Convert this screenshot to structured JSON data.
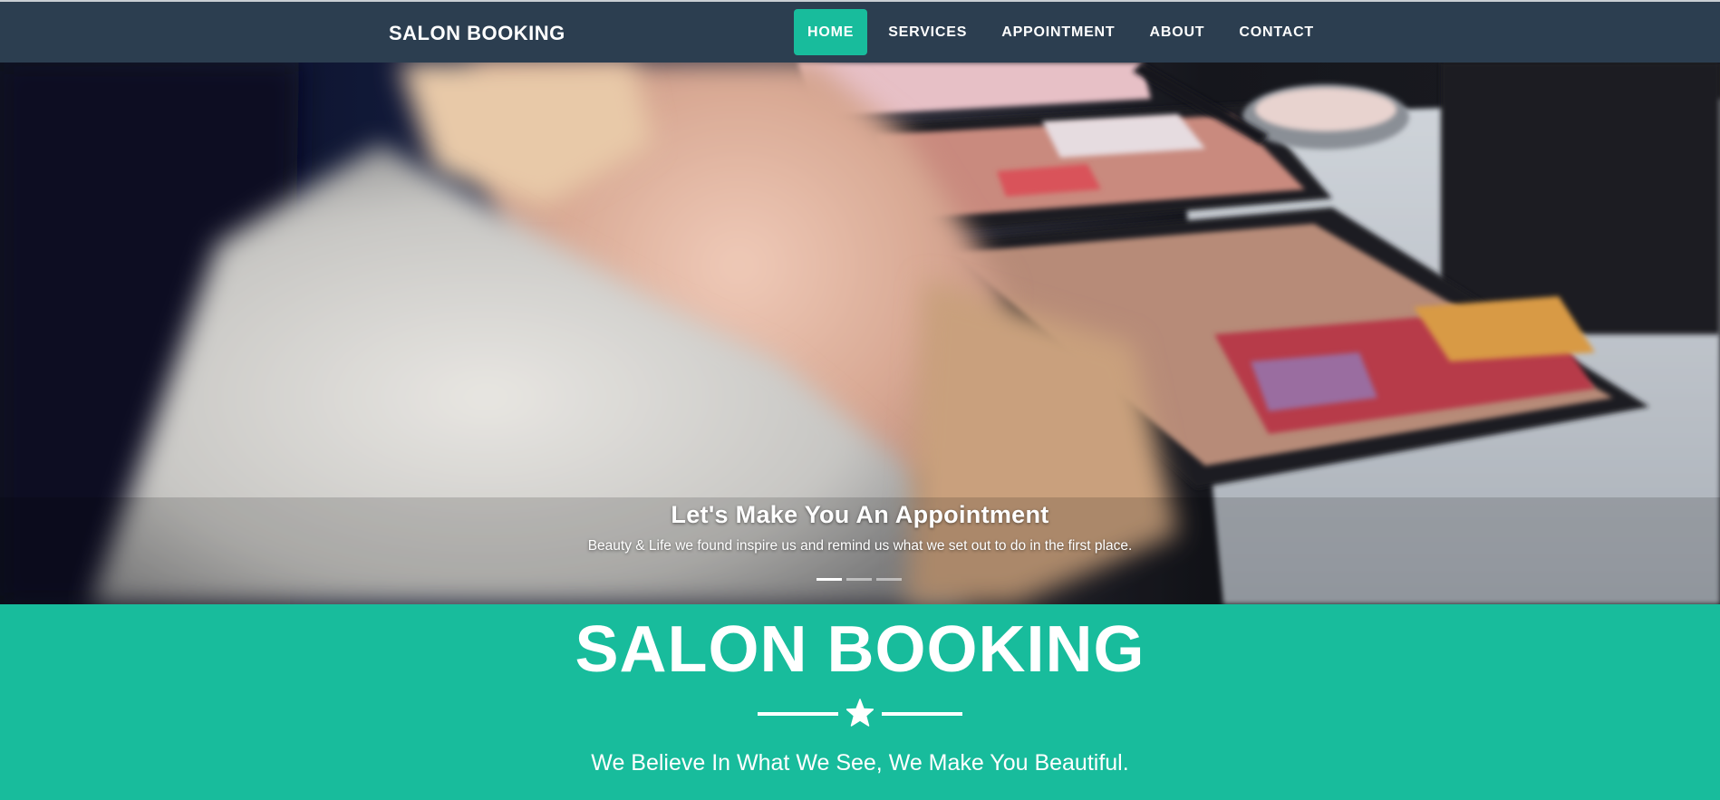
{
  "brand": "SALON BOOKING",
  "nav": {
    "items": [
      {
        "label": "HOME",
        "active": true
      },
      {
        "label": "SERVICES",
        "active": false
      },
      {
        "label": "APPOINTMENT",
        "active": false
      },
      {
        "label": "ABOUT",
        "active": false
      },
      {
        "label": "CONTACT",
        "active": false
      }
    ]
  },
  "hero": {
    "title": "Let's Make You An Appointment",
    "text": "Beauty & Life we found inspire us and remind us what we set out to do in the first place.",
    "slides_total": 3,
    "active_slide": 1
  },
  "masthead": {
    "title": "SALON BOOKING",
    "icon": "star-icon",
    "subtitle": "We Believe In What We See, We Make You Beautiful."
  },
  "colors": {
    "navbar": "#2c3e50",
    "accent": "#18bc9c",
    "text": "#ffffff"
  }
}
